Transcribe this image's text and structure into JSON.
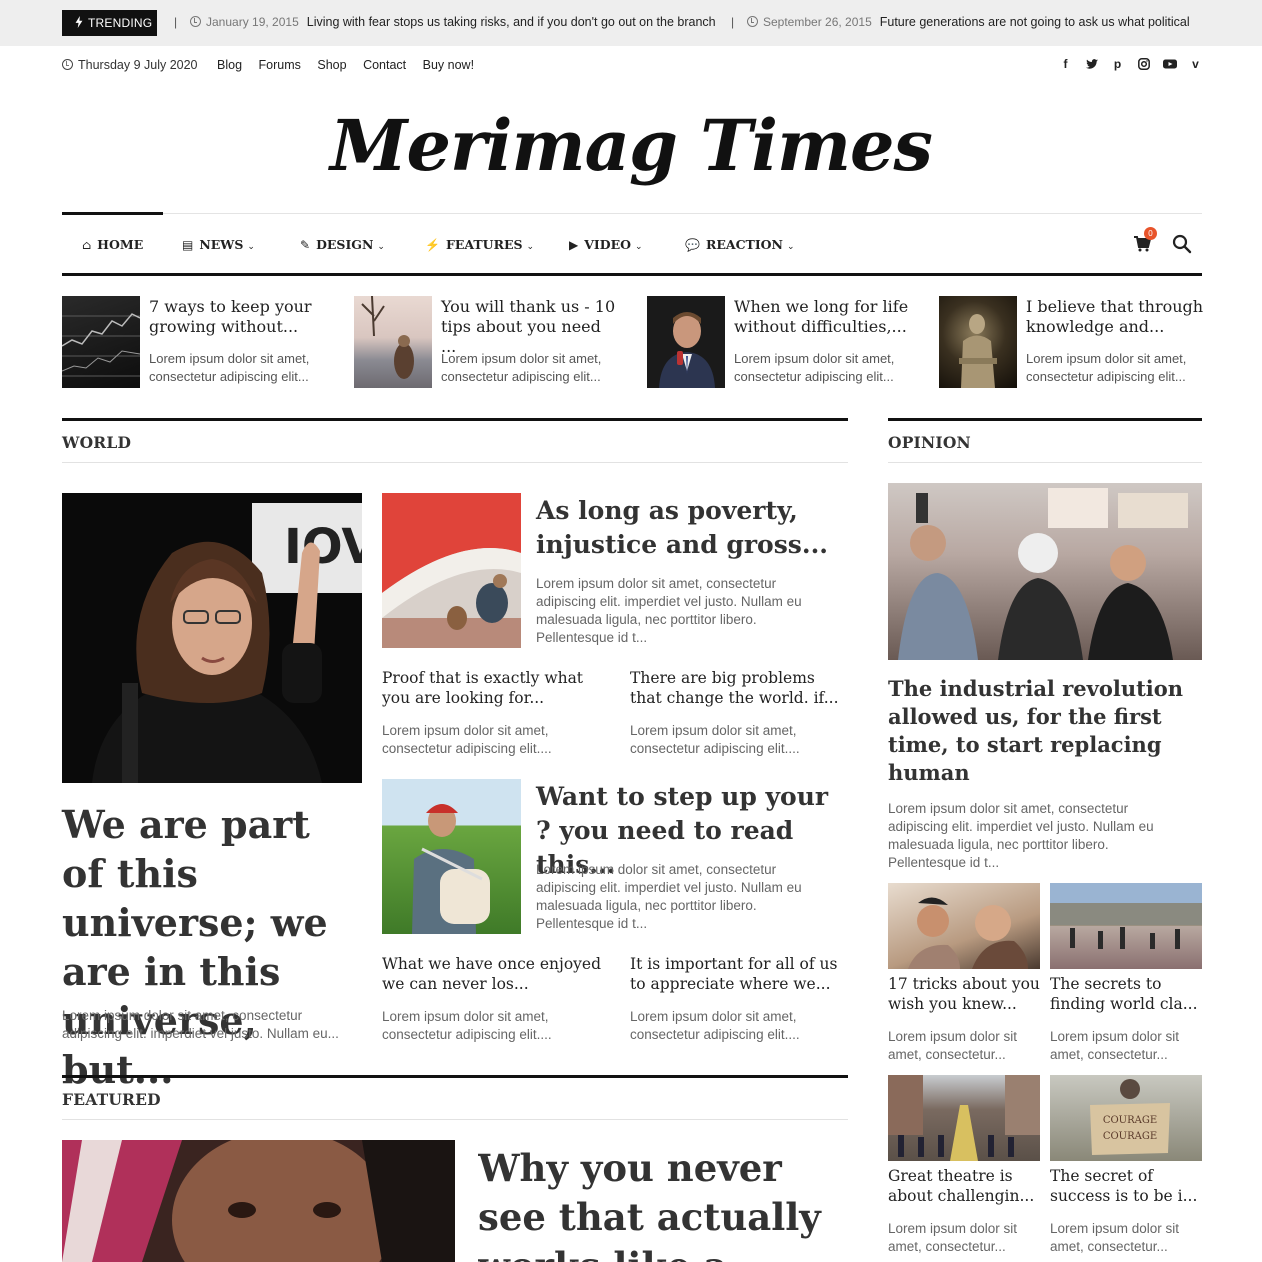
{
  "trending": {
    "label": "TRENDING",
    "items": [
      {
        "date": "January 19, 2015",
        "title": "Living with fear stops us taking risks, and if you don't go out on the branch"
      },
      {
        "date": "September 26, 2015",
        "title": "Future generations are not going to ask us what political"
      }
    ]
  },
  "topbar": {
    "date": "Thursday 9 July 2020",
    "links": [
      "Blog",
      "Forums",
      "Shop",
      "Contact",
      "Buy now!"
    ],
    "socials": [
      "facebook-icon",
      "twitter-icon",
      "pinterest-icon",
      "instagram-icon",
      "youtube-icon",
      "vimeo-icon"
    ]
  },
  "logo": "Merimag Times",
  "nav": {
    "items": [
      {
        "label": "HOME",
        "icon": "home-icon"
      },
      {
        "label": "NEWS",
        "icon": "newspaper-icon"
      },
      {
        "label": "DESIGN",
        "icon": "magic-wand-icon"
      },
      {
        "label": "FEATURES",
        "icon": "plug-icon"
      },
      {
        "label": "VIDEO",
        "icon": "play-icon"
      },
      {
        "label": "REACTION",
        "icon": "comments-icon"
      }
    ],
    "cart_count": "0"
  },
  "top_stories": [
    {
      "title": "7 ways to keep your growing without...",
      "excerpt": "Lorem ipsum dolor sit amet, consectetur adipiscing elit..."
    },
    {
      "title": "You will thank us - 10 tips about you need ...",
      "excerpt": "Lorem ipsum dolor sit amet, consectetur adipiscing elit..."
    },
    {
      "title": "When we long for life without difficulties,...",
      "excerpt": "Lorem ipsum dolor sit amet, consectetur adipiscing elit..."
    },
    {
      "title": "I believe that through knowledge and...",
      "excerpt": "Lorem ipsum dolor sit amet, consectetur adipiscing elit..."
    }
  ],
  "world": {
    "heading": "WORLD",
    "main": {
      "title": "We are part of this universe; we are in this universe, but...",
      "excerpt": "Lorem ipsum dolor sit amet, consectetur adipiscing elit. imperdiet vel justo. Nullam eu..."
    },
    "block1": {
      "title": "As long as poverty, injustice and gross...",
      "excerpt": "Lorem ipsum dolor sit amet, consectetur adipiscing elit. imperdiet vel justo. Nullam eu malesuada ligula, nec porttitor libero. Pellentesque id t..."
    },
    "sub1": [
      {
        "title": "Proof that is exactly what you are looking for...",
        "excerpt": "Lorem ipsum dolor sit amet, consectetur adipiscing elit...."
      },
      {
        "title": "There are big problems that change the world. if...",
        "excerpt": "Lorem ipsum dolor sit amet, consectetur adipiscing elit...."
      }
    ],
    "block2": {
      "title": "Want to step up your ? you need to read this...",
      "excerpt": "Lorem ipsum dolor sit amet, consectetur adipiscing elit. imperdiet vel justo. Nullam eu malesuada ligula, nec porttitor libero. Pellentesque id t..."
    },
    "sub2": [
      {
        "title": "What we have once enjoyed we can never los...",
        "excerpt": "Lorem ipsum dolor sit amet, consectetur adipiscing elit...."
      },
      {
        "title": "It is important for all of us to appreciate where we...",
        "excerpt": "Lorem ipsum dolor sit amet, consectetur adipiscing elit...."
      }
    ]
  },
  "opinion": {
    "heading": "OPINION",
    "main": {
      "title": "The industrial revolution allowed us, for the first time, to start replacing human",
      "excerpt": "Lorem ipsum dolor sit amet, consectetur adipiscing elit. imperdiet vel justo. Nullam eu malesuada ligula, nec porttitor libero. Pellentesque id t..."
    },
    "grid": [
      {
        "title": "17 tricks about you wish you knew...",
        "excerpt": "Lorem ipsum dolor sit amet, consectetur..."
      },
      {
        "title": "The secrets to finding world cla...",
        "excerpt": "Lorem ipsum dolor sit amet, consectetur..."
      },
      {
        "title": "Great theatre is about challengin...",
        "excerpt": "Lorem ipsum dolor sit amet, consectetur..."
      },
      {
        "title": "The secret of success is to be i...",
        "excerpt": "Lorem ipsum dolor sit amet, consectetur..."
      }
    ]
  },
  "featured": {
    "heading": "FEATURED",
    "title": "Why you never see that actually works like a"
  }
}
